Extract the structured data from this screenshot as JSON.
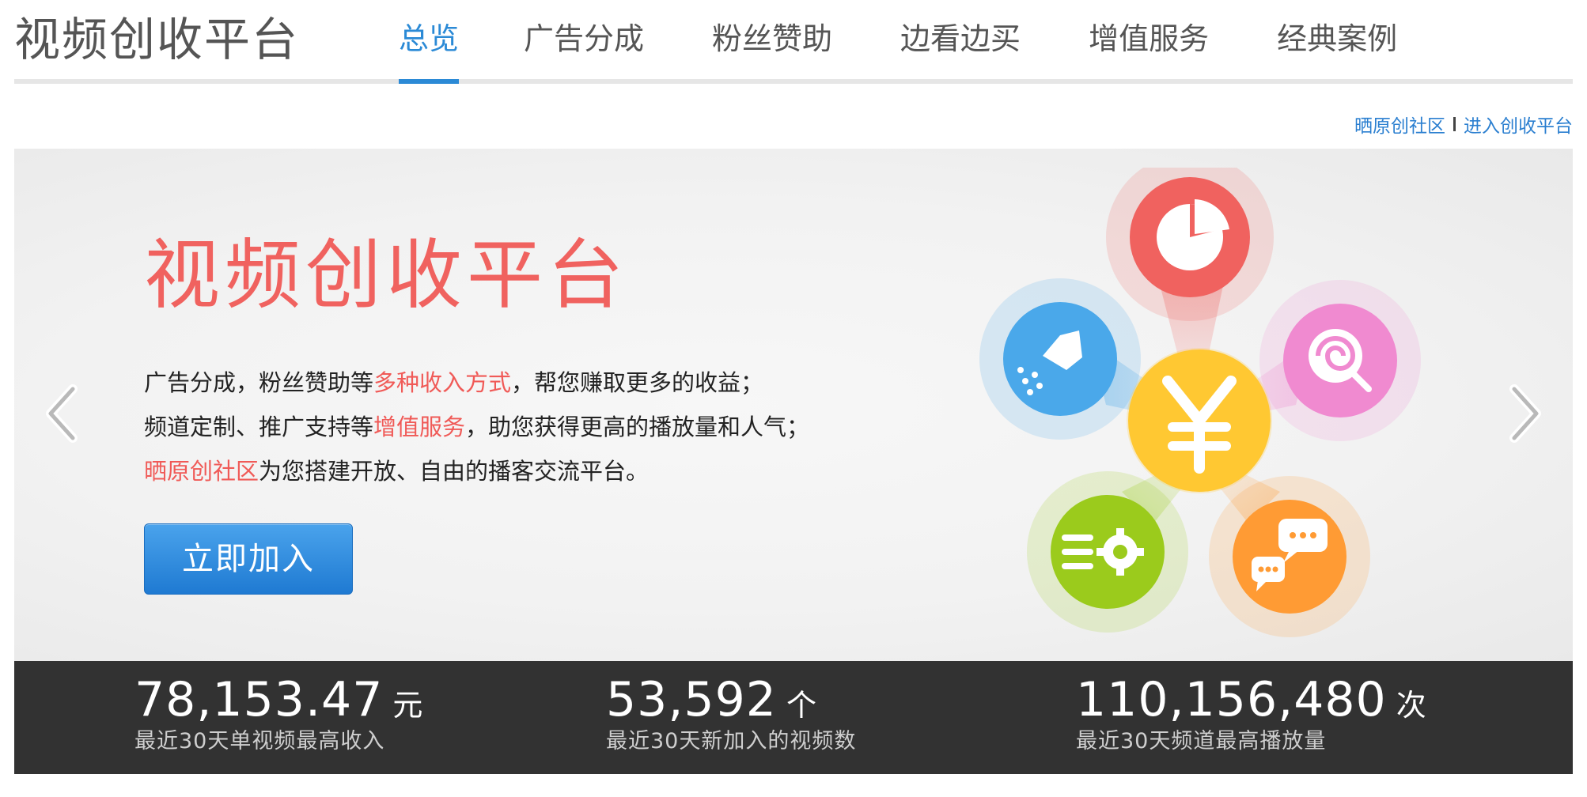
{
  "header": {
    "site_title": "视频创收平台",
    "nav": [
      {
        "label": "总览",
        "active": true
      },
      {
        "label": "广告分成",
        "active": false
      },
      {
        "label": "粉丝赞助",
        "active": false
      },
      {
        "label": "边看边买",
        "active": false
      },
      {
        "label": "增值服务",
        "active": false
      },
      {
        "label": "经典案例",
        "active": false
      }
    ]
  },
  "top_links": {
    "community": "晒原创社区",
    "enter_platform": "进入创收平台"
  },
  "banner": {
    "title": "视频创收平台",
    "line1": {
      "pre": "广告分成，粉丝赞助等",
      "highlight": "多种收入方式",
      "post": "，帮您赚取更多的收益；"
    },
    "line2": {
      "pre": "频道定制、推广支持等",
      "highlight": "增值服务",
      "post": "，助您获得更高的播放量和人气；"
    },
    "line3": {
      "highlight": "晒原创社区",
      "post": "为您搭建开放、自由的播客交流平台。"
    },
    "join_button": "立即加入",
    "icons": [
      "pie-chart-icon",
      "watering-can-icon",
      "lollipop-icon",
      "yen-icon",
      "settings-list-icon",
      "chat-bubbles-icon"
    ]
  },
  "stats": [
    {
      "value": "78,153.47",
      "unit": "元",
      "label": "最近30天单视频最高收入"
    },
    {
      "value": "53,592",
      "unit": "个",
      "label": "最近30天新加入的视频数"
    },
    {
      "value": "110,156,480",
      "unit": "次",
      "label": "最近30天频道最高播放量"
    }
  ],
  "colors": {
    "accent_blue": "#2b8ad6",
    "highlight_red": "#f0625f",
    "stats_bg": "#323232",
    "pie_red": "#f0625f",
    "water_blue": "#4aa8ea",
    "lollipop_pink": "#f08ad0",
    "yen_yellow": "#ffc832",
    "settings_green": "#9bcb1c",
    "chat_orange": "#ff9b34"
  }
}
